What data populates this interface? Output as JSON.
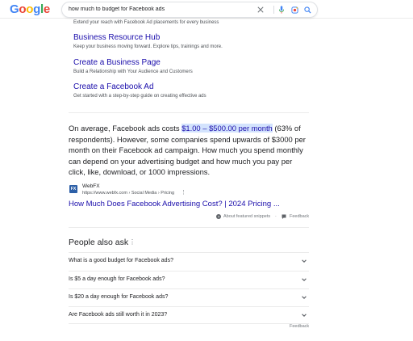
{
  "header": {
    "logo_letters": [
      {
        "ch": "G",
        "color": "#4285f4"
      },
      {
        "ch": "o",
        "color": "#ea4335"
      },
      {
        "ch": "o",
        "color": "#fbbc05"
      },
      {
        "ch": "g",
        "color": "#4285f4"
      },
      {
        "ch": "l",
        "color": "#34a853"
      },
      {
        "ch": "e",
        "color": "#ea4335"
      }
    ],
    "query": "how much to budget for Facebook ads"
  },
  "sitelinks": {
    "top_desc": "Extend your reach with Facebook Ad placements for every business",
    "items": [
      {
        "title": "Business Resource Hub",
        "desc": "Keep your business moving forward. Explore tips, trainings and more."
      },
      {
        "title": "Create a Business Page",
        "desc": "Build a Relationship with Your Audience and Customers"
      },
      {
        "title": "Create a Facebook Ad",
        "desc": "Get started with a step-by-step guide on creating effective ads"
      }
    ]
  },
  "featured_snippet": {
    "text_before": "On average, Facebook ads costs ",
    "highlight": "$1.00 – $500.00 per month",
    "text_after": " (63% of respondents). However, some companies spend upwards of $3000 per month on their Facebook ad campaign. How much you spend monthly can depend on your advertising budget and how much you pay per click, like, download, or 1000 impressions.",
    "source_favicon": "FX",
    "source_name": "WebFX",
    "source_url": "https://www.webfx.com › Social Media › Pricing",
    "result_title": "How Much Does Facebook Advertising Cost? | 2024 Pricing ...",
    "about_label": "About featured snippets",
    "separator": "·",
    "feedback_label": "Feedback"
  },
  "people_also_ask": {
    "heading": "People also ask",
    "questions": [
      "What is a good budget for Facebook ads?",
      "Is $5 a day enough for Facebook ads?",
      "Is $20 a day enough for Facebook ads?",
      "Are Facebook ads still worth it in 2023?"
    ],
    "feedback_label": "Feedback"
  },
  "colors": {
    "link": "#1a0dab",
    "highlight_bg": "#d3e3fd",
    "text": "#202124",
    "muted": "#70757a"
  }
}
